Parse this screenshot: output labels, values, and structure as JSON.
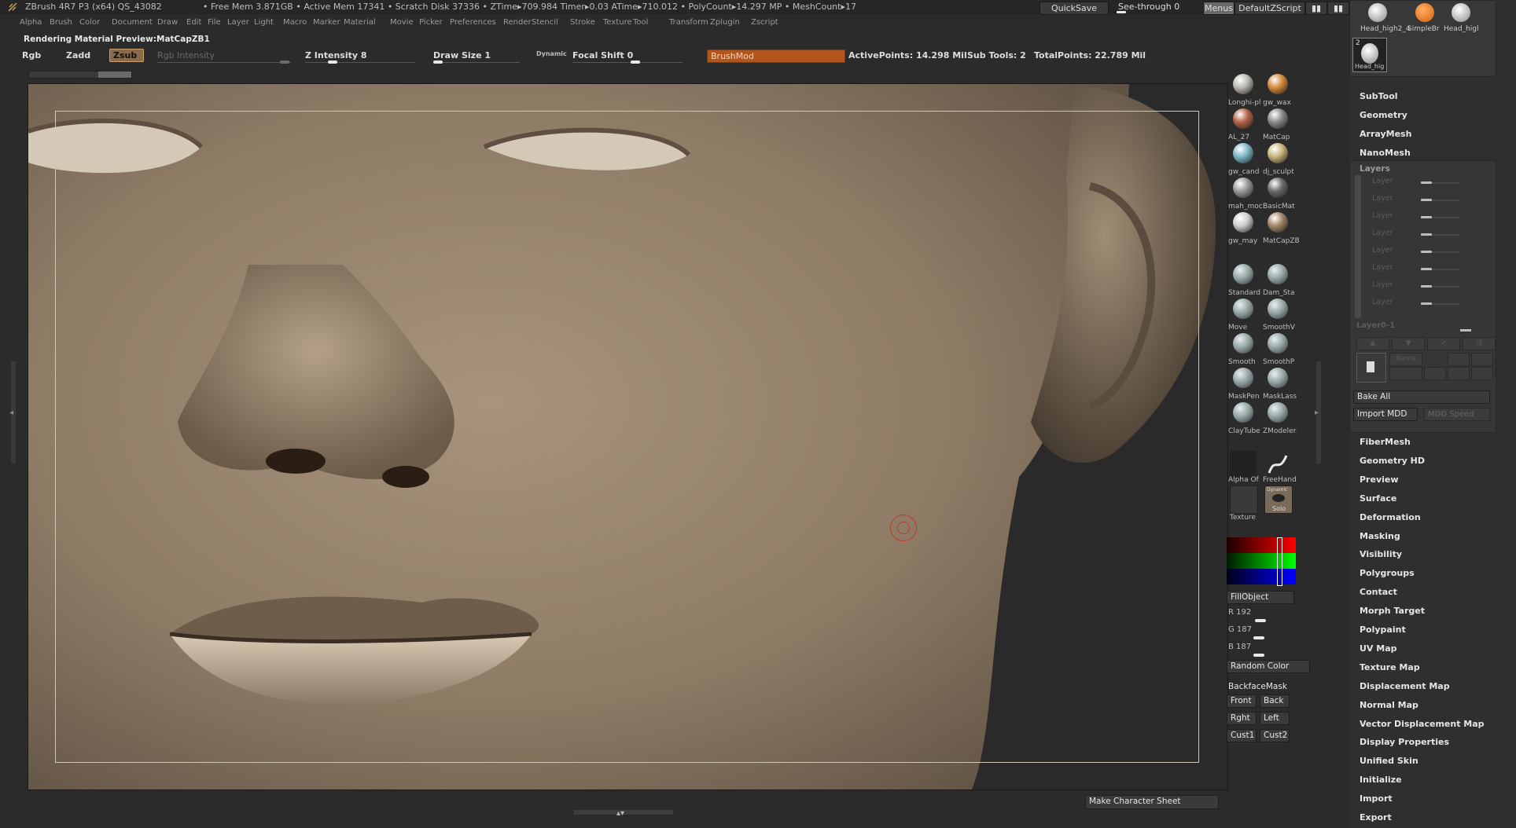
{
  "titlebar": {
    "title": "ZBrush 4R7 P3 (x64)    QS_43082",
    "stats": "• Free Mem 3.871GB  • Active Mem 17341  • Scratch Disk 37336  •  ZTime▸709.984 Timer▸0.03 ATime▸710.012 • PolyCount▸14.297 MP   • MeshCount▸17",
    "quicksave": "QuickSave",
    "see_through": "See-through   0",
    "menus": "Menus",
    "default_zscript": "DefaultZScript"
  },
  "menubar": [
    "Alpha",
    "Brush",
    "Color",
    "Document",
    "Draw",
    "Edit",
    "File",
    "Layer",
    "Light",
    "Macro",
    "Marker",
    "Material",
    "Movie",
    "Picker",
    "Preferences",
    "Render",
    "Stencil",
    "Stroke",
    "Texture",
    "Tool",
    "Transform",
    "Zplugin",
    "Zscript"
  ],
  "status_text": "Rendering Material Preview:MatCapZB1",
  "toolbar": {
    "rgb": "Rgb",
    "zadd": "Zadd",
    "zsub": "Zsub",
    "rgb_intensity": "Rgb Intensity",
    "z_intensity": "Z Intensity 8",
    "draw_size": "Draw Size 1",
    "dynamic": "Dynamic",
    "focal_shift": "Focal Shift 0",
    "brush_mod": "BrushMod",
    "active_points": "ActivePoints: 14.298 Mil",
    "sub_tools": "Sub Tools: 2",
    "total_points": "TotalPoints: 22.789 Mil"
  },
  "materials": [
    {
      "label": "Longhi-pl",
      "color": "#bdb8b2"
    },
    {
      "label": "gw_wax",
      "color": "#d48a3a"
    },
    {
      "label": "AL_27",
      "color": "#b4644a"
    },
    {
      "label": "MatCap",
      "color": "#8a8a88"
    },
    {
      "label": "gw_cand",
      "color": "#7fb8c8"
    },
    {
      "label": "dj_sculpt",
      "color": "#c9b47a"
    },
    {
      "label": "mah_moc",
      "color": "#9a9a9a"
    },
    {
      "label": "BasicMat",
      "color": "#6a6a6a"
    },
    {
      "label": "gw_may",
      "color": "#cfcfcf"
    },
    {
      "label": "MatCapZB",
      "color": "#a38668"
    }
  ],
  "brushes": [
    {
      "label": "Standard"
    },
    {
      "label": "Dam_Sta"
    },
    {
      "label": "Move"
    },
    {
      "label": "SmoothV"
    },
    {
      "label": "Smooth"
    },
    {
      "label": "SmoothP"
    },
    {
      "label": "MaskPen"
    },
    {
      "label": "MaskLass"
    },
    {
      "label": "ClayTube"
    },
    {
      "label": "ZModeler"
    }
  ],
  "stroke": {
    "alpha": "Alpha  Of",
    "freehand": "FreeHand",
    "texture": "Texture",
    "solo": "Solo",
    "dynamic": "Dynamic"
  },
  "color": {
    "fill_object": "FillObject",
    "r": "R 192",
    "g": "G 187",
    "b": "B 187",
    "random_color": "Random Color",
    "backface_mask": "BackfaceMask"
  },
  "views": {
    "front": "Front",
    "back": "Back",
    "right": "Rght",
    "left": "Left",
    "cust1": "Cust1",
    "cust2": "Cust2"
  },
  "bottom": {
    "make_character_sheet": "Make Character Sheet"
  },
  "subtools_top": [
    {
      "label": "Head_high2_4"
    },
    {
      "label": "SimpleBr"
    },
    {
      "label": "Head_higl"
    },
    {
      "label": "Head_hig",
      "badge": "2"
    }
  ],
  "rpanel": {
    "items_top": [
      "SubTool",
      "Geometry",
      "ArrayMesh",
      "NanoMesh"
    ],
    "layers_title": "Layers",
    "layer_rows": [
      "Layer",
      "Layer",
      "Layer",
      "Layer",
      "Layer",
      "Layer",
      "Layer",
      "Layer"
    ],
    "layer_name": "Layer0-1",
    "name_btn": "Name",
    "bake_all": "Bake All",
    "import_mdd": "Import MDD",
    "mdd_speed": "MDD Speed",
    "items_bottom": [
      "FiberMesh",
      "Geometry HD",
      "Preview",
      "Surface",
      "Deformation",
      "Masking",
      "Visibility",
      "Polygroups",
      "Contact",
      "Morph Target",
      "Polypaint",
      "UV Map",
      "Texture Map",
      "Displacement Map",
      "Normal Map",
      "Vector Displacement Map",
      "Display Properties",
      "Unified Skin",
      "Initialize",
      "Import",
      "Export"
    ]
  }
}
